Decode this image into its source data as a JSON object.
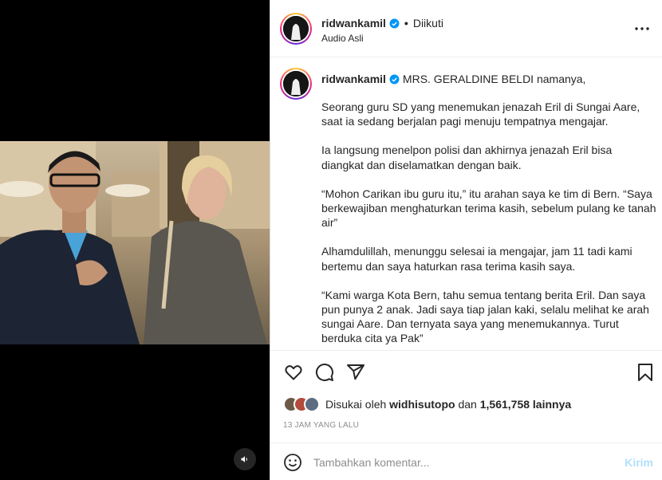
{
  "header": {
    "username": "ridwankamil",
    "separator": "•",
    "follow_status": "Diikuti",
    "audio": "Audio Asli"
  },
  "caption": {
    "username": "ridwankamil",
    "first_line": "MRS. GERALDINE BELDI namanya,",
    "paragraphs": [
      "Seorang guru SD yang menemukan jenazah Eril di Sungai Aare, saat ia sedang berjalan pagi menuju tempatnya mengajar.",
      "Ia langsung menelpon polisi dan akhirnya jenazah Eril bisa diangkat dan diselamatkan dengan baik.",
      "“Mohon Carikan ibu guru itu,” itu arahan saya ke tim di Bern. “Saya berkewajiban menghaturkan terima kasih, sebelum pulang ke tanah air”",
      "Alhamdulillah, menunggu selesai ia mengajar, jam 11 tadi kami bertemu dan saya haturkan rasa terima kasih saya.",
      "“Kami warga Kota Bern, tahu semua tentang berita Eril. Dan saya pun punya 2 anak. Jadi saya tiap jalan kaki, selalu melihat ke arah sungai Aare. Dan ternyata saya yang menemukannya. Turut berduka cita ya Pak”"
    ]
  },
  "likes": {
    "prefix": "Disukai oleh",
    "user": "widhisutopo",
    "middle": "dan",
    "count": "1,561,758 lainnya"
  },
  "time_ago": "13 JAM YANG LALU",
  "comment": {
    "placeholder": "Tambahkan komentar...",
    "post_label": "Kirim"
  },
  "colors": {
    "verified": "#0095f6",
    "post_disabled": "#b2dffc",
    "muted": "#8e8e8e"
  },
  "icons": [
    "speaker-icon",
    "more-icon",
    "verified-icon",
    "heart-icon",
    "comment-icon",
    "share-icon",
    "bookmark-icon",
    "emoji-icon"
  ]
}
